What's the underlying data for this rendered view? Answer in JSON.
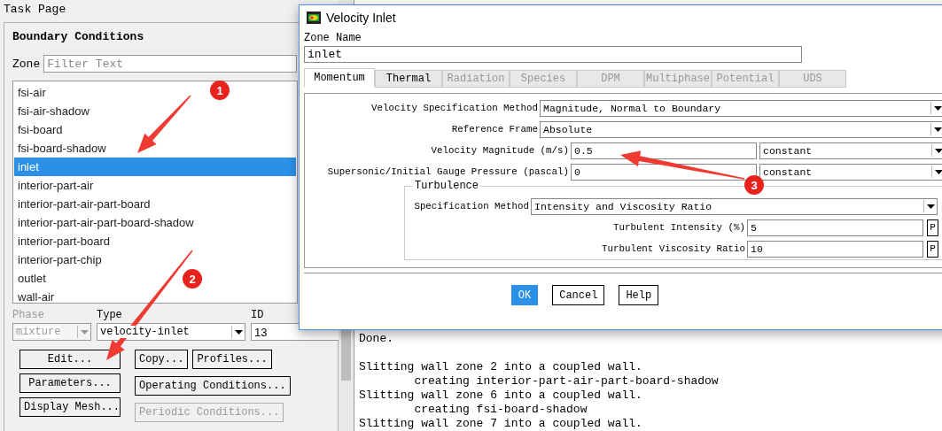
{
  "task_page": {
    "title": "Task Page",
    "heading": "Boundary Conditions",
    "zone_label": "Zone",
    "zone_filter": {
      "placeholder": "Filter Text"
    },
    "zones": [
      {
        "label": "fsi-air",
        "selected": false
      },
      {
        "label": "fsi-air-shadow",
        "selected": false
      },
      {
        "label": "fsi-board",
        "selected": false
      },
      {
        "label": "fsi-board-shadow",
        "selected": false
      },
      {
        "label": "inlet",
        "selected": true
      },
      {
        "label": "interior-part-air",
        "selected": false
      },
      {
        "label": "interior-part-air-part-board",
        "selected": false
      },
      {
        "label": "interior-part-air-part-board-shadow",
        "selected": false
      },
      {
        "label": "interior-part-board",
        "selected": false
      },
      {
        "label": "interior-part-chip",
        "selected": false
      },
      {
        "label": "outlet",
        "selected": false
      },
      {
        "label": "wall-air",
        "selected": false
      }
    ],
    "phase": {
      "label": "Phase",
      "value": "mixture",
      "disabled": true
    },
    "type": {
      "label": "Type",
      "value": "velocity-inlet",
      "disabled": false
    },
    "id": {
      "label": "ID",
      "value": "13"
    },
    "button_columns": [
      {
        "rows": [
          [
            {
              "label": "Edit...",
              "disabled": false
            }
          ],
          [
            {
              "label": "Parameters...",
              "disabled": false
            }
          ],
          [
            {
              "label": "Display Mesh...",
              "disabled": false
            }
          ]
        ]
      },
      {
        "rows": [
          [
            {
              "label": "Copy...",
              "disabled": false
            },
            {
              "label": "Profiles...",
              "disabled": false
            }
          ],
          [
            {
              "label": "Operating Conditions...",
              "disabled": false
            }
          ],
          [
            {
              "label": "Periodic Conditions...",
              "disabled": true
            }
          ]
        ]
      }
    ]
  },
  "console": {
    "paragraphs": [
      [
        "Done."
      ],
      [
        "Slitting wall zone 2 into a coupled wall.",
        "        creating interior-part-air-part-board-shadow",
        "Slitting wall zone 6 into a coupled wall.",
        "        creating fsi-board-shadow",
        "Slitting wall zone 7 into a coupled wall."
      ]
    ]
  },
  "dialog": {
    "title": "Velocity Inlet",
    "zone_name_label": "Zone Name",
    "zone_name": "inlet",
    "tabs": [
      {
        "label": "Momentum",
        "selected": true,
        "disabled": false
      },
      {
        "label": "Thermal",
        "selected": false,
        "disabled": false
      },
      {
        "label": "Radiation",
        "selected": false,
        "disabled": true
      },
      {
        "label": "Species",
        "selected": false,
        "disabled": true
      },
      {
        "label": "DPM",
        "selected": false,
        "disabled": true
      },
      {
        "label": "Multiphase",
        "selected": false,
        "disabled": true
      },
      {
        "label": "Potential",
        "selected": false,
        "disabled": true
      },
      {
        "label": "UDS",
        "selected": false,
        "disabled": true
      }
    ],
    "rows": [
      {
        "kind": "dropdown",
        "label": "Velocity Specification Method",
        "value": "Magnitude, Normal to Boundary"
      },
      {
        "kind": "dropdown",
        "label": "Reference Frame",
        "value": "Absolute"
      },
      {
        "kind": "value",
        "label": "Velocity Magnitude (m/s)",
        "value": "0.5",
        "method": "constant"
      },
      {
        "kind": "value",
        "label": "Supersonic/Initial Gauge Pressure (pascal)",
        "value": "0",
        "method": "constant"
      }
    ],
    "turbulence": {
      "title": "Turbulence",
      "rows": [
        {
          "kind": "dropdown",
          "label": "Specification Method",
          "value": "Intensity and Viscosity Ratio"
        },
        {
          "kind": "profile",
          "label": "Turbulent Intensity (%)",
          "value": "5",
          "button": "P"
        },
        {
          "kind": "profile",
          "label": "Turbulent Viscosity Ratio",
          "value": "10",
          "button": "P"
        }
      ]
    },
    "buttons": [
      {
        "label": "OK",
        "default": true
      },
      {
        "label": "Cancel",
        "default": false
      },
      {
        "label": "Help",
        "default": false
      }
    ]
  },
  "annotations": [
    {
      "number": "1"
    },
    {
      "number": "2"
    },
    {
      "number": "3"
    }
  ]
}
